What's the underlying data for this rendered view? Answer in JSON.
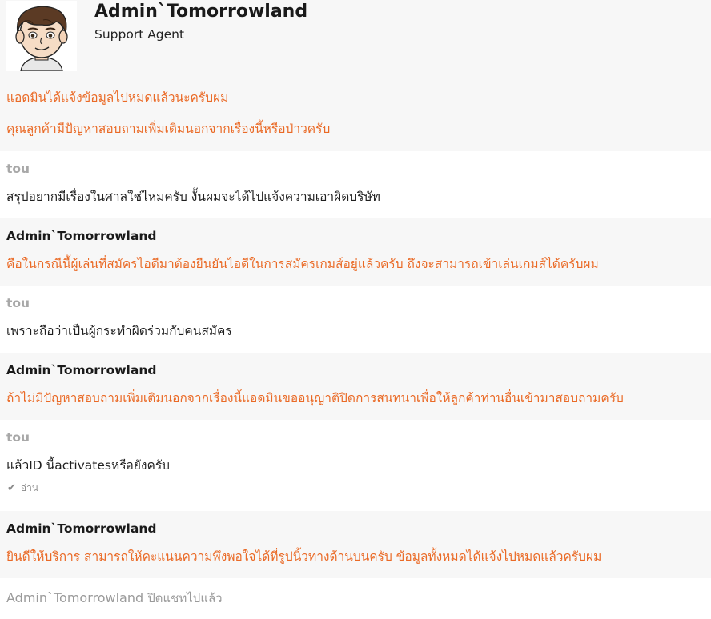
{
  "header": {
    "name": "Admin`Tomorrowland",
    "role": "Support Agent"
  },
  "intro": {
    "line1": "แอดมินได้แจ้งข้อมูลไปหมดแล้วนะครับผม",
    "line2": "คุณลูกค้ามีปัญหาสอบถามเพิ่มเติมนอกจากเรื่องนี้หรือป่าวครับ"
  },
  "messages": [
    {
      "sender": "tou",
      "text": "สรุปอยากมีเรื่องในศาลใช่ไหมครับ งั้นผมจะได้ไปแจ้งความเอาผิดบริษัท"
    },
    {
      "sender": "Admin`Tomorrowland",
      "text": "คือในกรณีนี้ผู้เล่นที่สมัครไอดีมาต้องยืนยันไอดีในการสมัครเกมส์อยู่แล้วครับ ถึงจะสามารถเข้าเล่นเกมส์ได้ครับผม"
    },
    {
      "sender": "tou",
      "text": "เพราะถือว่าเป็นผู้กระทำผิดร่วมกับคนสมัคร"
    },
    {
      "sender": "Admin`Tomorrowland",
      "text": "ถ้าไม่มีปัญหาสอบถามเพิ่มเติมนอกจากเรื่องนี้แอดมินขออนุญาติปิดการสนทนาเพื่อให้ลูกค้าท่านอื่นเข้ามาสอบถามครับ"
    },
    {
      "sender": "tou",
      "text": "แล้วID นี้activatesหรือยังครับ",
      "status": "อ่าน"
    },
    {
      "sender": "Admin`Tomorrowland",
      "text": "ยินดีให้บริการ สามารถให้คะแนนความพึงพอใจได้ที่รูปนิ้วทางด้านบนครับ ข้อมูลทั้งหมดได้แจ้งไปหมดแล้วครับผม"
    }
  ],
  "footer": {
    "closed_name": "Admin`Tomorrowland",
    "closed_text": "ปิดแชทไปแล้ว"
  },
  "colors": {
    "agent_text": "#ea6a26",
    "agent_bg": "#f7f7f7",
    "user_name": "#a8a8a8"
  },
  "icons": {
    "avatar": "cartoon-boy-avatar",
    "read": "check-icon"
  }
}
